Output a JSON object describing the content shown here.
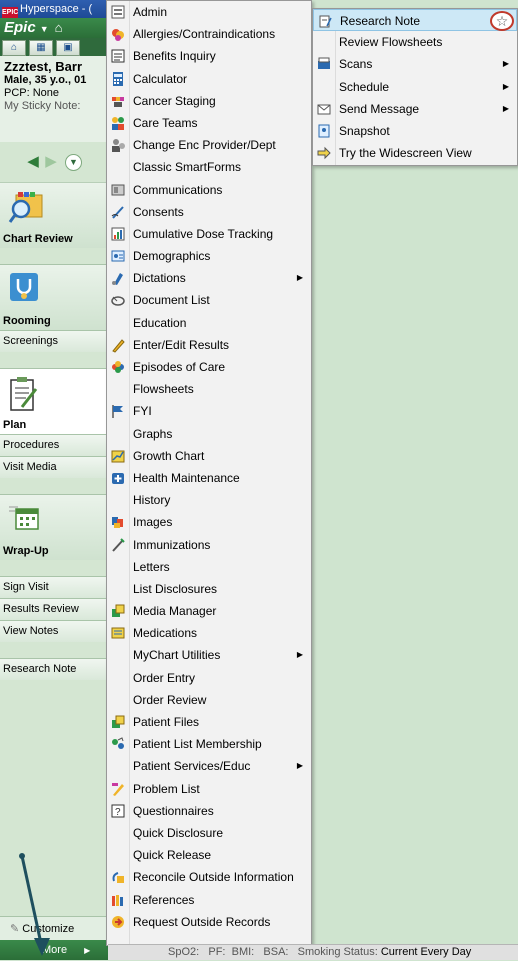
{
  "titlebar": {
    "title": "Hyperspace - ("
  },
  "epicbar": {
    "logo": "Epic"
  },
  "patient": {
    "name": "Zzztest, Barr",
    "demo": "Male, 35 y.o., 01",
    "pcp": "PCP: None",
    "sticky": "My Sticky Note: "
  },
  "nav": {
    "chart_review": "Chart Review",
    "rooming": "Rooming",
    "screenings": "Screenings",
    "plan": "Plan",
    "procedures": "Procedures",
    "visit_media": "Visit Media",
    "wrap_up": "Wrap-Up",
    "sign_visit": "Sign Visit",
    "results_review": "Results Review",
    "view_notes": "View Notes",
    "research_note": "Research Note",
    "customize": "Customize",
    "more": "More"
  },
  "menu": {
    "items": [
      {
        "label": "Admin",
        "icon": "admin-icon"
      },
      {
        "label": "Allergies/Contraindications",
        "icon": "allergies-icon"
      },
      {
        "label": "Benefits Inquiry",
        "icon": "benefits-icon"
      },
      {
        "label": "Calculator",
        "icon": "calculator-icon"
      },
      {
        "label": "Cancer Staging",
        "icon": "cancer-staging-icon"
      },
      {
        "label": "Care Teams",
        "icon": "care-teams-icon"
      },
      {
        "label": "Change Enc Provider/Dept",
        "icon": "change-provider-icon"
      },
      {
        "label": "Classic SmartForms",
        "icon": ""
      },
      {
        "label": "Communications",
        "icon": "communications-icon"
      },
      {
        "label": "Consents",
        "icon": "consents-icon"
      },
      {
        "label": "Cumulative Dose Tracking",
        "icon": "dose-tracking-icon"
      },
      {
        "label": "Demographics",
        "icon": "demographics-icon"
      },
      {
        "label": "Dictations",
        "icon": "dictations-icon",
        "submenu": true
      },
      {
        "label": "Document List",
        "icon": "document-list-icon"
      },
      {
        "label": "Education",
        "icon": ""
      },
      {
        "label": "Enter/Edit Results",
        "icon": "edit-results-icon"
      },
      {
        "label": "Episodes of Care",
        "icon": "episodes-icon"
      },
      {
        "label": "Flowsheets",
        "icon": ""
      },
      {
        "label": "FYI",
        "icon": "fyi-flag-icon"
      },
      {
        "label": "Graphs",
        "icon": ""
      },
      {
        "label": "Growth Chart",
        "icon": "growth-chart-icon"
      },
      {
        "label": "Health Maintenance",
        "icon": "health-maintenance-icon"
      },
      {
        "label": "History",
        "icon": ""
      },
      {
        "label": "Images",
        "icon": "images-icon"
      },
      {
        "label": "Immunizations",
        "icon": "immunizations-icon"
      },
      {
        "label": "Letters",
        "icon": ""
      },
      {
        "label": "List Disclosures",
        "icon": ""
      },
      {
        "label": "Media Manager",
        "icon": "media-manager-icon"
      },
      {
        "label": "Medications",
        "icon": "medications-icon"
      },
      {
        "label": "MyChart Utilities",
        "icon": "",
        "submenu": true
      },
      {
        "label": "Order Entry",
        "icon": ""
      },
      {
        "label": "Order Review",
        "icon": ""
      },
      {
        "label": "Patient Files",
        "icon": "patient-files-icon"
      },
      {
        "label": "Patient List Membership",
        "icon": "patient-list-icon"
      },
      {
        "label": "Patient Services/Educ",
        "icon": "",
        "submenu": true
      },
      {
        "label": "Problem List",
        "icon": "problem-list-icon"
      },
      {
        "label": "Questionnaires",
        "icon": "questionnaires-icon"
      },
      {
        "label": "Quick Disclosure",
        "icon": ""
      },
      {
        "label": "Quick Release",
        "icon": ""
      },
      {
        "label": "Reconcile Outside Information",
        "icon": "reconcile-icon"
      },
      {
        "label": "References",
        "icon": "references-icon"
      },
      {
        "label": "Request Outside Records",
        "icon": "request-records-icon"
      }
    ]
  },
  "submenu": {
    "items": [
      {
        "label": "Research Note",
        "icon": "research-note-icon",
        "highlighted": true
      },
      {
        "label": "Review Flowsheets",
        "icon": ""
      },
      {
        "label": "Scans",
        "icon": "scans-icon",
        "submenu": true
      },
      {
        "label": "Schedule",
        "icon": "",
        "submenu": true
      },
      {
        "label": "Send Message",
        "icon": "send-message-icon",
        "submenu": true
      },
      {
        "label": "Snapshot",
        "icon": "snapshot-icon"
      },
      {
        "label": "Try the Widescreen View",
        "icon": "widescreen-arrow-icon"
      }
    ]
  },
  "statusbar": {
    "spo2": "SpO2:",
    "pf": "PF:",
    "bmi": "BMI:",
    "bsa": "BSA:",
    "smoking_label": "Smoking Status:",
    "smoking_value": "Current Every Day"
  }
}
